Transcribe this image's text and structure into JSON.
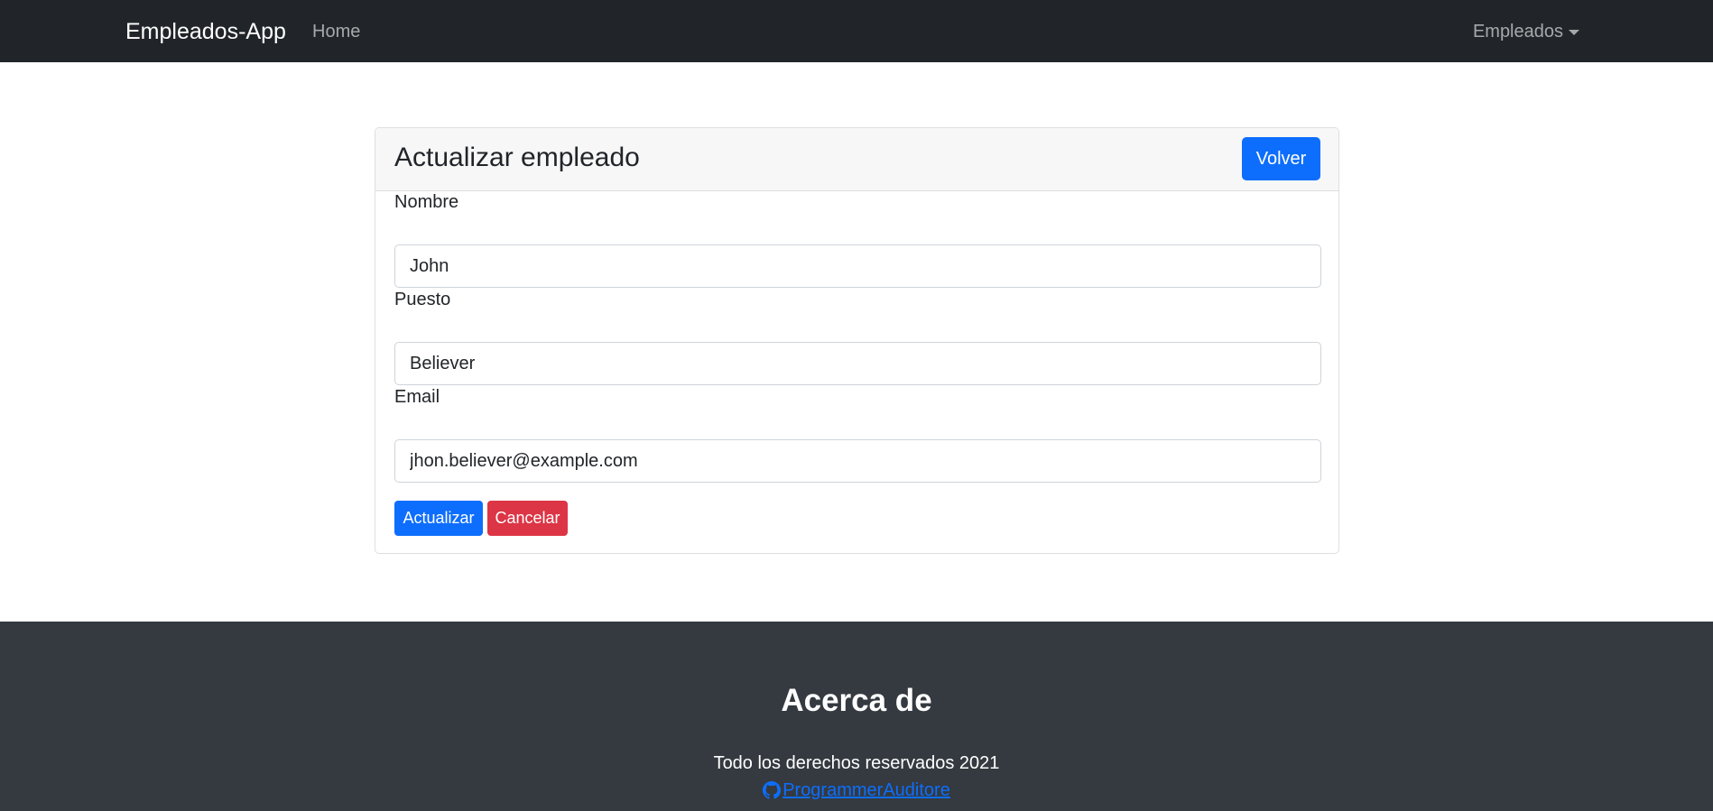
{
  "navbar": {
    "brand": "Empleados-App",
    "home_label": "Home",
    "dropdown_label": "Empleados"
  },
  "card": {
    "title": "Actualizar empleado",
    "back_label": "Volver",
    "fields": [
      {
        "label": "Nombre",
        "value": "John"
      },
      {
        "label": "Puesto",
        "value": "Believer"
      },
      {
        "label": "Email",
        "value": "jhon.believer@example.com"
      }
    ],
    "update_label": "Actualizar",
    "cancel_label": "Cancelar"
  },
  "footer": {
    "title": "Acerca de",
    "copyright": "Todo los derechos reservados 2021",
    "link_label": "ProgrammerAuditore",
    "link_icon": "github-icon"
  },
  "colors": {
    "navbar": "#212529",
    "footer": "#343a40",
    "primary": "#0d6efd",
    "danger": "#dc3545"
  }
}
